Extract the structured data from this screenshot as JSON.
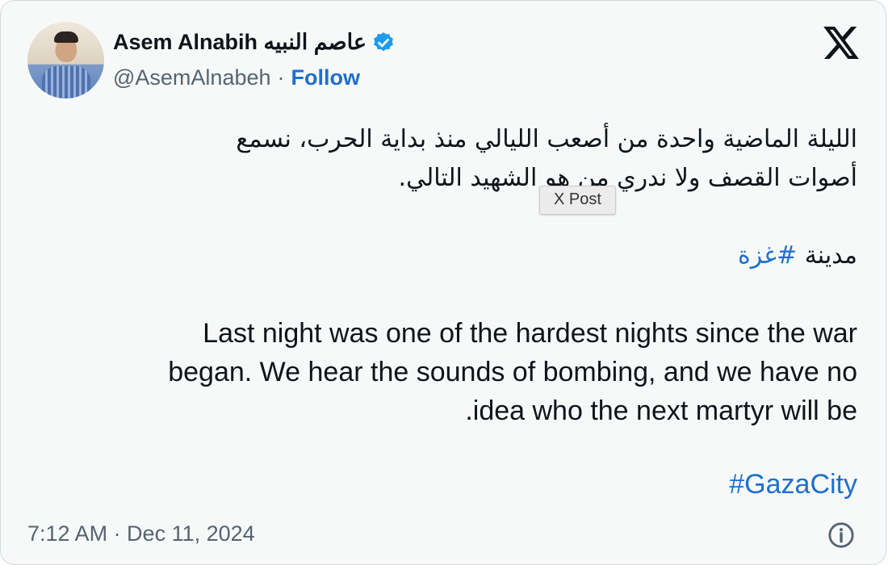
{
  "author": {
    "display_name": "Asem Alnabih عاصم النبيه",
    "handle": "@AsemAlnabeh",
    "separator": "·",
    "follow_label": "Follow",
    "verified_icon": "verified-badge-icon",
    "verified_color": "#1d9bf0"
  },
  "post": {
    "arabic_line_1": "الليلة الماضية واحدة من أصعب الليالي منذ بداية الحرب، نسمع",
    "arabic_line_2": "أصوات القصف ولا ندري من هو الشهيد التالي.",
    "arabic_city_word": "مدينة",
    "arabic_hashtag": "#غزة",
    "english_line_1": "Last night was one of the hardest nights since the war",
    "english_line_2": "began. We hear the sounds of bombing, and we have no",
    "english_line_3": ".idea who the next martyr will be",
    "english_hashtag": "#GazaCity",
    "tooltip": "X Post"
  },
  "footer": {
    "timestamp": "7:12 AM · Dec 11, 2024",
    "info_icon": "info-icon"
  },
  "colors": {
    "link": "#1d6fd1",
    "muted": "#536471",
    "card_bg": "#f7f9f9"
  }
}
